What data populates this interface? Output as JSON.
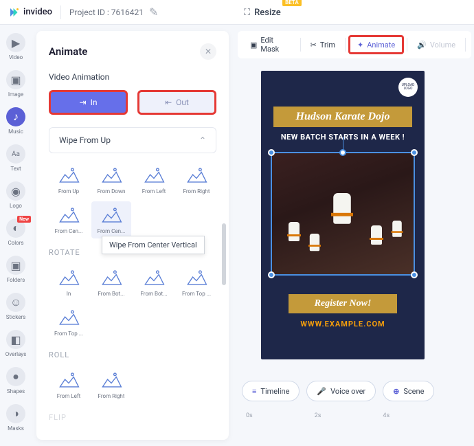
{
  "logo_text": "invideo",
  "project_id": "Project ID : 7616421",
  "resize_label": "Resize",
  "beta": "BETA",
  "left_nav": [
    {
      "icon": "video",
      "label": "Video"
    },
    {
      "icon": "image",
      "label": "Image"
    },
    {
      "icon": "music",
      "label": "Music",
      "active": true
    },
    {
      "icon": "text",
      "label": "Text"
    },
    {
      "icon": "logo",
      "label": "Logo"
    },
    {
      "icon": "colors",
      "label": "Colors",
      "badge": "New"
    },
    {
      "icon": "folders",
      "label": "Folders"
    },
    {
      "icon": "stickers",
      "label": "Stickers"
    },
    {
      "icon": "overlays",
      "label": "Overlays"
    },
    {
      "icon": "shapes",
      "label": "Shapes"
    },
    {
      "icon": "masks",
      "label": "Masks"
    }
  ],
  "panel": {
    "title": "Animate",
    "section": "Video Animation",
    "in_label": "In",
    "out_label": "Out",
    "dropdown": "Wipe From Up",
    "tooltip": "Wipe From Center Vertical",
    "wipe": [
      "From Up",
      "From Down",
      "From Left",
      "From Right",
      "From Cen...",
      "From Cen..."
    ],
    "rotate_title": "ROTATE",
    "rotate": [
      "In",
      "From Bot...",
      "From Bot...",
      "From Top ...",
      "From Top ..."
    ],
    "roll_title": "ROLL",
    "roll": [
      "From Left",
      "From Right"
    ],
    "flip_title": "FLIP"
  },
  "toolbar": {
    "edit_mask": "Edit Mask",
    "trim": "Trim",
    "animate": "Animate",
    "volume": "Volume"
  },
  "canvas": {
    "logo_text": "UPLOAD LOGO",
    "title": "Hudson Karate Dojo",
    "subtitle": "NEW BATCH STARTS IN A WEEK !",
    "register": "Register Now!",
    "website": "WWW.EXAMPLE.COM"
  },
  "bottom": {
    "timeline": "Timeline",
    "voiceover": "Voice over",
    "scene": "Scene"
  },
  "ruler": [
    "0s",
    "2s",
    "4s"
  ]
}
